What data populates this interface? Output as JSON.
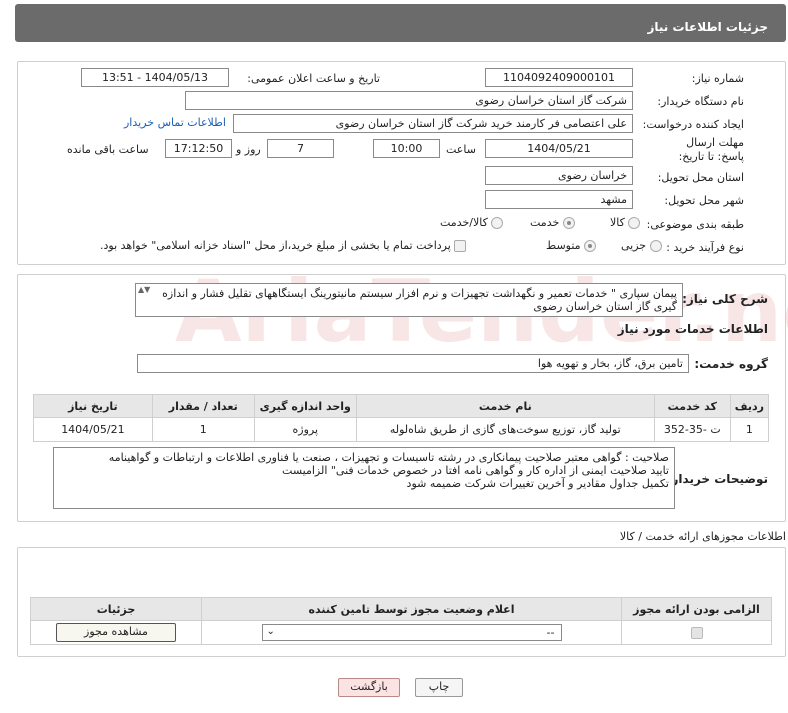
{
  "header": {
    "title": "جزئیات اطلاعات نیاز"
  },
  "need_number": {
    "label": "شماره نیاز:",
    "value": "1104092409000101"
  },
  "announce_datetime": {
    "label": "تاریخ و ساعت اعلان عمومی:",
    "value": "1404/05/13 - 13:51"
  },
  "buyer_org": {
    "label": "نام دستگاه خریدار:",
    "value": "شرکت گاز استان خراسان رضوی"
  },
  "requester": {
    "label": "ایجاد کننده درخواست:",
    "value": "علی اعتصامی فر کارمند خرید شرکت گاز استان خراسان رضوی",
    "contact_link": "اطلاعات تماس خریدار"
  },
  "deadline": {
    "label": "مهلت ارسال پاسخ: تا تاریخ:",
    "date": "1404/05/21",
    "time_label": "ساعت",
    "time": "10:00",
    "days": "7",
    "days_label": "روز و",
    "remaining": "17:12:50",
    "remaining_label": "ساعت باقی مانده"
  },
  "province": {
    "label": "استان محل تحویل:",
    "value": "خراسان رضوی"
  },
  "city": {
    "label": "شهر محل تحویل:",
    "value": "مشهد"
  },
  "category": {
    "label": "طبقه بندی موضوعی:",
    "options": [
      "کالا",
      "خدمت",
      "کالا/خدمت"
    ],
    "selected": "خدمت"
  },
  "process": {
    "label": "نوع فرآیند خرید :",
    "options": [
      "جزیی",
      "متوسط"
    ],
    "selected": "متوسط",
    "note": "پرداخت تمام یا بخشی از مبلغ خرید،از محل \"اسناد خزانه اسلامی\" خواهد بود."
  },
  "summary": {
    "label": "شرح کلی نیاز:",
    "text": "پیمان سپاری \" خدمات تعمیر و نگهداشت تجهیزات و نرم افزار سیستم مانیتورینگ ایستگاههای تقلیل فشار و اندازه گیری گاز استان خراسان رضوی"
  },
  "services_title": "اطلاعات خدمات مورد نیاز",
  "service_group": {
    "label": "گروه خدمت:",
    "value": "تامین برق، گاز، بخار و تهویه هوا"
  },
  "services_table": {
    "headers": [
      "ردیف",
      "کد خدمت",
      "نام خدمت",
      "واحد اندازه گیری",
      "تعداد / مقدار",
      "تاریخ نیاز"
    ],
    "rows": [
      [
        "1",
        "ت -35-352",
        "تولید گاز، توزیع سوخت‌های گازی از طریق شاه‌لوله",
        "پروژه",
        "1",
        "1404/05/21"
      ]
    ]
  },
  "buyer_notes": {
    "label": "توضیحات خریدار:",
    "lines": [
      "صلاحیت : گواهی معتبر صلاحیت پیمانکاری در رشته تاسیسات و تجهیزات ، صنعت یا فناوری اطلاعات و ارتباطات و  گواهینامه",
      "تایید صلاحیت ایمنی از اداره کار  و گواهی نامه افتا در خصوص خدمات فنی\" الزامیست",
      "تکمیل جداول مقادیر و آخرین تغییرات شرکت ضمیمه شود"
    ]
  },
  "permits": {
    "title": "اطلاعات مجوزهای ارائه خدمت / کالا",
    "headers": [
      "الزامی بودن ارائه مجوز",
      "اعلام وضعیت مجوز توسط تامین کننده",
      "جزئیات"
    ],
    "select_value": "--",
    "view_button": "مشاهده مجوز"
  },
  "footer": {
    "print_button": "چاپ",
    "back_button": "بازگشت"
  },
  "watermark": "AriaTender.neT"
}
